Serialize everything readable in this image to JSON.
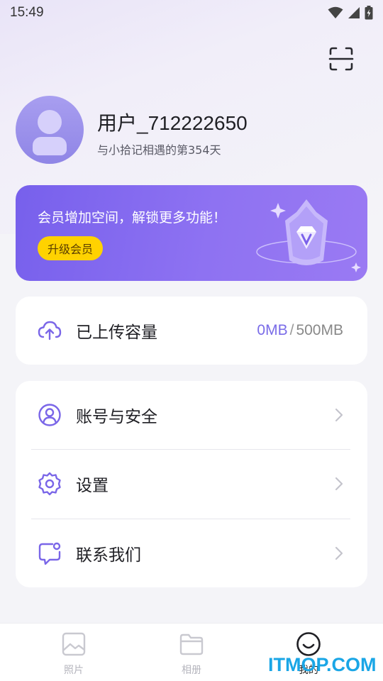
{
  "status_bar": {
    "time": "15:49"
  },
  "header": {
    "scan_icon": "scan-icon"
  },
  "profile": {
    "username": "用户_712222650",
    "subtitle": "与小拾记相遇的第354天"
  },
  "vip": {
    "text": "会员增加空间，解锁更多功能！",
    "button": "升级会员",
    "accent": "#7a62ec",
    "button_color": "#ffd200"
  },
  "upload": {
    "label": "已上传容量",
    "used": "0MB",
    "separator": "/",
    "total": "500MB",
    "icon": "cloud-upload-icon"
  },
  "menu": {
    "items": [
      {
        "label": "账号与安全",
        "icon": "account-icon"
      },
      {
        "label": "设置",
        "icon": "gear-icon"
      },
      {
        "label": "联系我们",
        "icon": "chat-icon"
      }
    ]
  },
  "tabbar": {
    "tabs": [
      {
        "label": "照片",
        "icon": "photo-icon",
        "active": false
      },
      {
        "label": "相册",
        "icon": "folder-icon",
        "active": false
      },
      {
        "label": "我的",
        "icon": "smile-icon",
        "active": true
      }
    ]
  },
  "watermark": "ITMOP.COM"
}
